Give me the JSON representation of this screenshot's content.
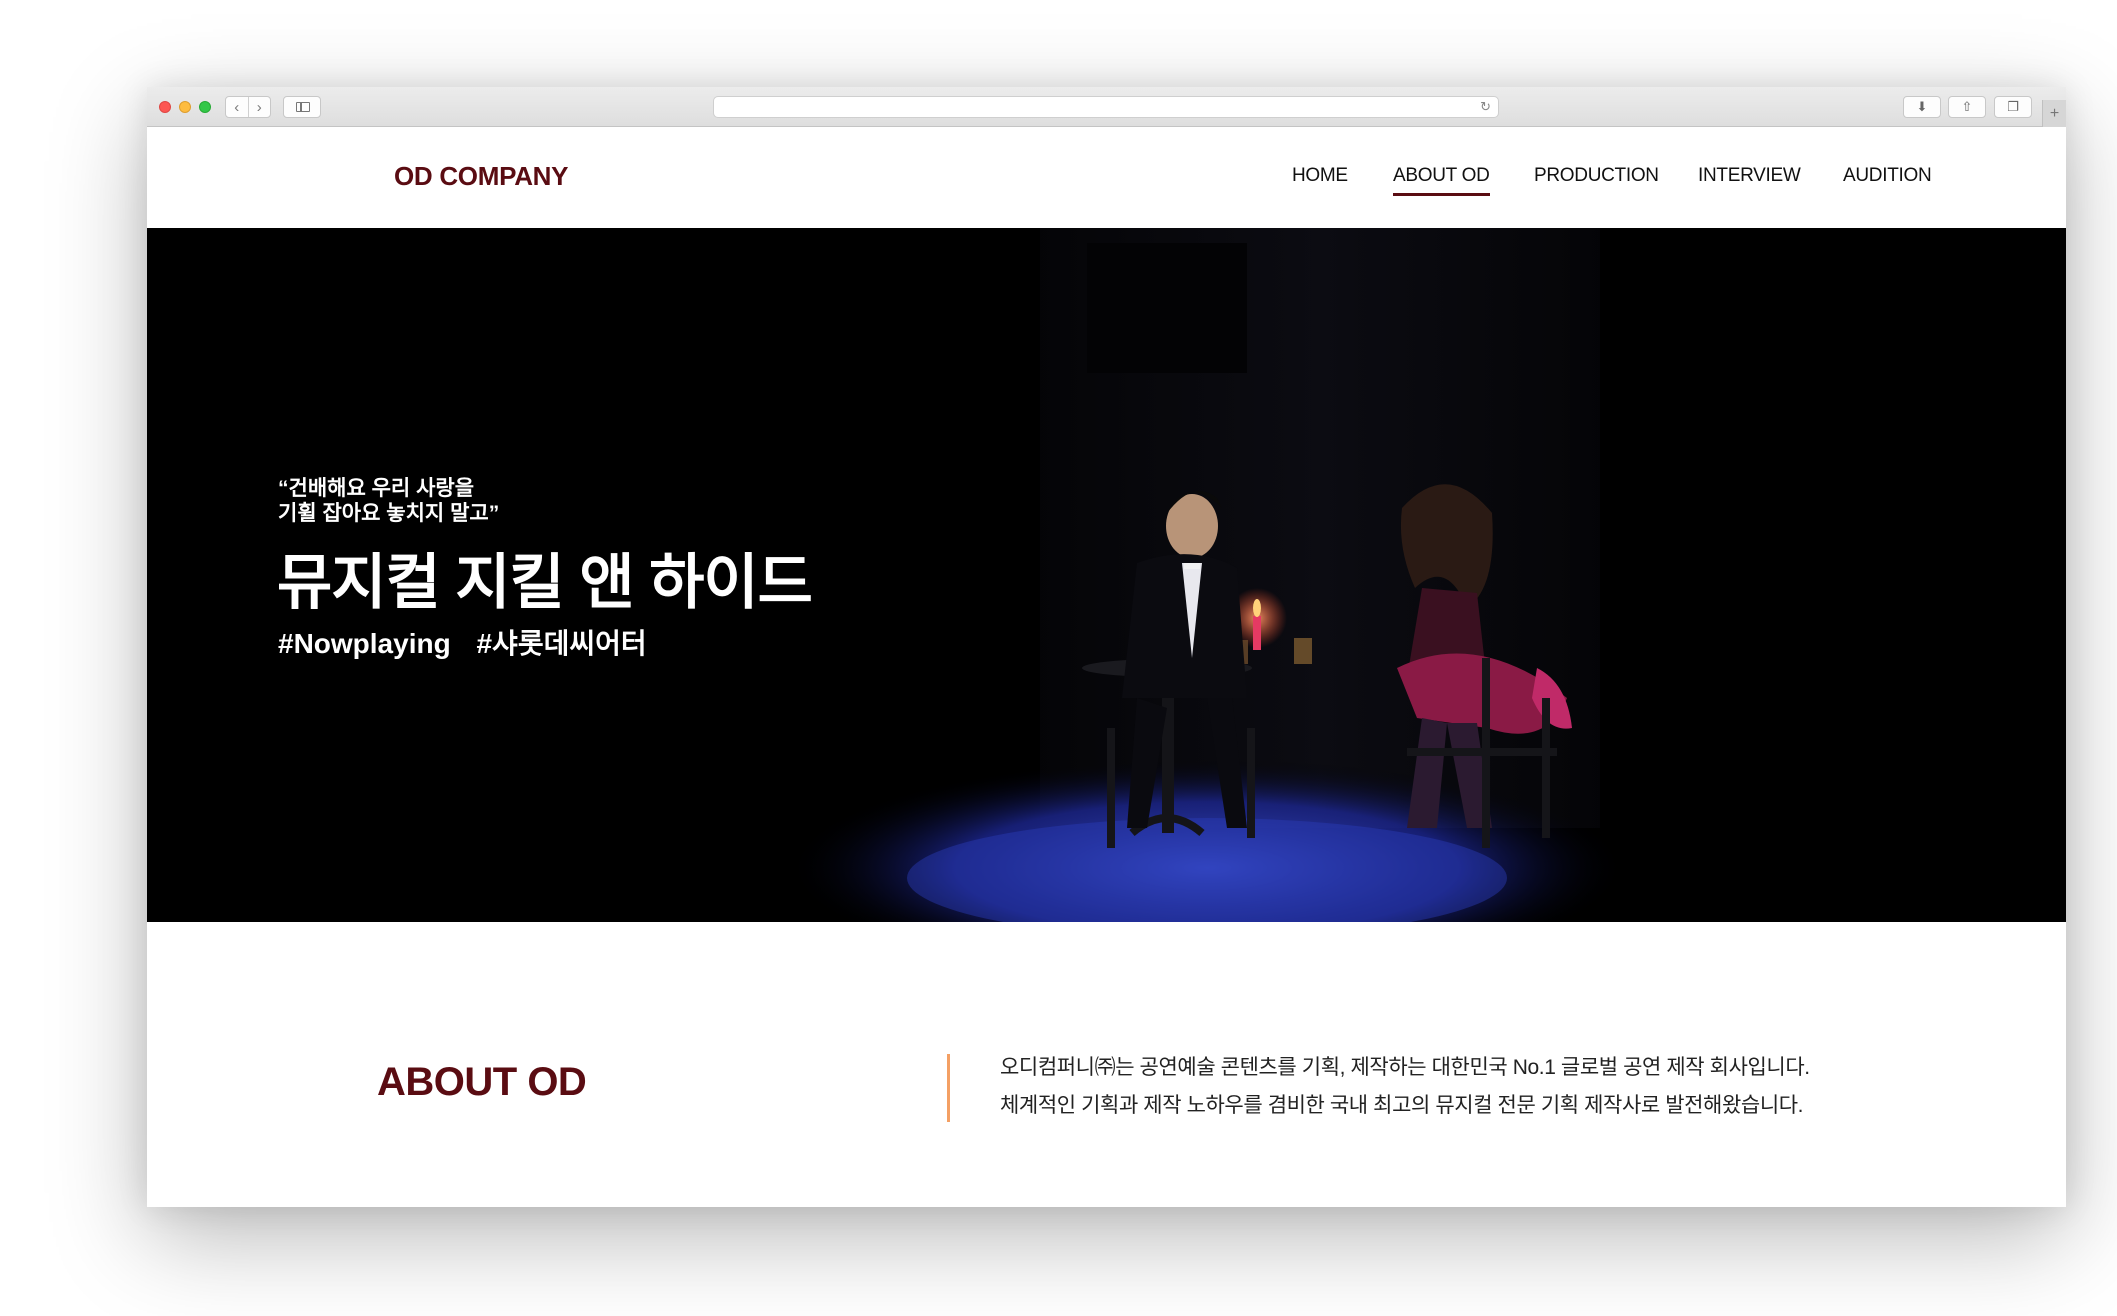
{
  "browser": {
    "nav_back_glyph": "‹",
    "nav_forward_glyph": "›",
    "reload_glyph": "↻",
    "download_glyph": "⬇",
    "share_glyph": "⇧",
    "tabs_glyph": "❐",
    "newtab_glyph": "+"
  },
  "site": {
    "logo": "OD COMPANY",
    "brand_color": "#5a0c12",
    "accent_color": "#f4a064",
    "menu": [
      {
        "label": "HOME",
        "active": false
      },
      {
        "label": "ABOUT OD",
        "active": true
      },
      {
        "label": "PRODUCTION",
        "active": false
      },
      {
        "label": "INTERVIEW",
        "active": false
      },
      {
        "label": "AUDITION",
        "active": false
      }
    ]
  },
  "hero": {
    "quote": "“건배해요 우리 사랑을\n기휠 잡아요 놓치지 말고”",
    "title": "뮤지컬 지킬 앤 하이드",
    "tags": [
      "#Nowplaying",
      "#샤롯데씨어터"
    ]
  },
  "about": {
    "title": "ABOUT OD",
    "lines": [
      "오디컴퍼니㈜는 공연예술 콘텐츠를 기획, 제작하는 대한민국 No.1 글로벌 공연 제작 회사입니다.",
      "체계적인 기획과 제작 노하우를 겸비한 국내 최고의 뮤지컬 전문 기획 제작사로 발전해왔습니다."
    ]
  }
}
